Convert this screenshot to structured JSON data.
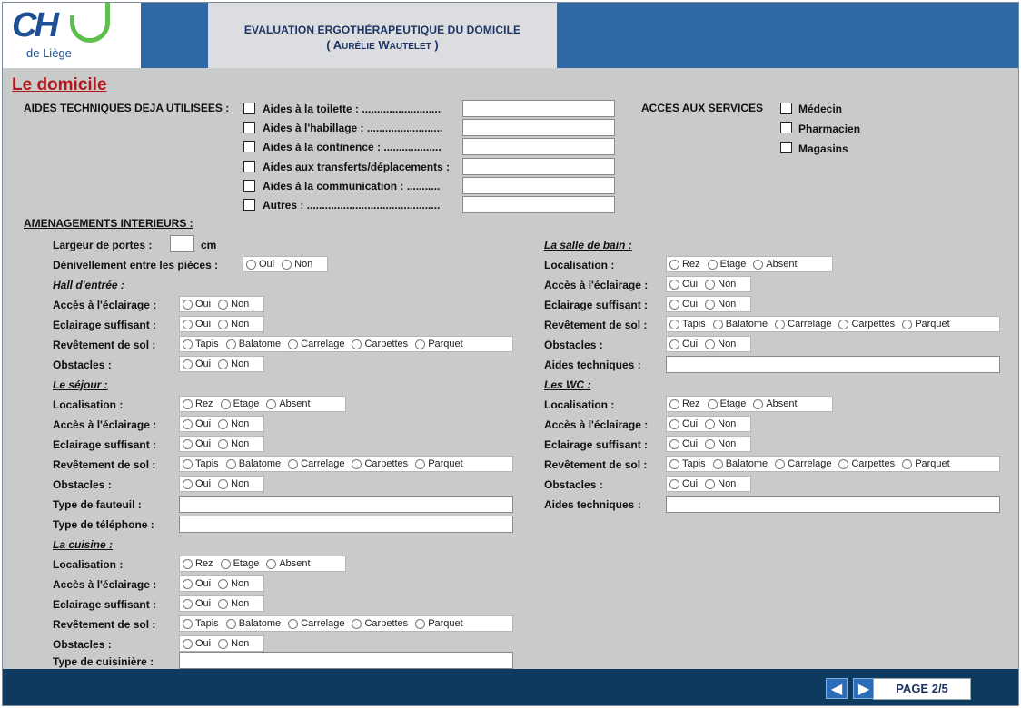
{
  "header": {
    "logo_main": "CH",
    "logo_sub": "de Liège",
    "title": "EVALUATION ERGOTHÉRAPEUTIQUE DU DOMICILE",
    "subtitle_open": "( A",
    "subtitle_small1": "URÉLIE",
    "subtitle_mid": " W",
    "subtitle_small2": "AUTELET",
    "subtitle_close": " )"
  },
  "section_title": "Le domicile",
  "aides_techniques": {
    "heading": "AIDES TECHNIQUES DEJA UTILISEES :",
    "items": [
      "Aides à la toilette : ..........................",
      "Aides à l'habillage : .........................",
      "Aides à la continence : ...................",
      "Aides aux transferts/déplacements :",
      "Aides à la communication : ...........",
      "Autres : ............................................"
    ]
  },
  "acces_services": {
    "heading": "ACCES AUX SERVICES",
    "items": [
      "Médecin",
      "Pharmacien",
      "Magasins"
    ]
  },
  "amenagements": {
    "heading": "AMENAGEMENTS INTERIEURS :",
    "largeur_label": "Largeur de portes :",
    "largeur_unit": "cm",
    "denivellement_label": "Dénivellement entre les pièces :"
  },
  "labels": {
    "localisation": "Localisation :",
    "acces_eclairage": "Accès à l'éclairage :",
    "eclairage_suffisant": "Eclairage suffisant :",
    "revetement": "Revêtement de sol :",
    "obstacles": "Obstacles :",
    "aides_techniques": "Aides techniques :",
    "type_fauteuil": "Type de fauteuil :",
    "type_telephone": "Type de téléphone :",
    "type_cuisiniere": "Type de cuisinière :"
  },
  "options": {
    "oui": "Oui",
    "non": "Non",
    "rez": "Rez",
    "etage": "Etage",
    "absent": "Absent",
    "tapis": "Tapis",
    "balatome": "Balatome",
    "carrelage": "Carrelage",
    "carpettes": "Carpettes",
    "parquet": "Parquet"
  },
  "rooms": {
    "hall": "Hall d'entrée :",
    "sejour": "Le séjour :",
    "cuisine": "La cuisine :",
    "salle_de_bain": "La salle de bain :",
    "wc": "Les WC :"
  },
  "footer": {
    "prev_icon": "arrow-left-icon",
    "next_icon": "arrow-right-icon",
    "page": "PAGE 2/5"
  }
}
